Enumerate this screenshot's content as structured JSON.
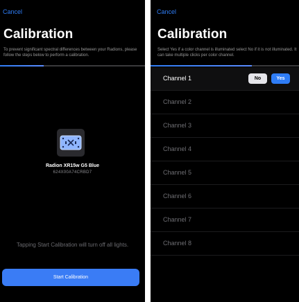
{
  "left_screen": {
    "cancel_label": "Cancel",
    "title": "Calibration",
    "description": "To prevent significant spectral differences between your Radions, please follow the steps below to perform a calibration.",
    "progress": 0.3,
    "device": {
      "icon": "light-fixture-icon",
      "name": "Radion XR15w G5 Blue",
      "serial": "624X00A74CRBD7"
    },
    "hint": "Tapping Start Calibration will turn off all lights.",
    "start_button_label": "Start Calibration"
  },
  "right_screen": {
    "cancel_label": "Cancel",
    "title": "Calibration",
    "description": "Select Yes if a color channel is illuminated select No if it is not illuminated. It can take multiple clicks per color channel.",
    "progress": 0.68,
    "no_label": "No",
    "yes_label": "Yes",
    "channels": [
      {
        "label": "Channel 1"
      },
      {
        "label": "Channel 2"
      },
      {
        "label": "Channel 3"
      },
      {
        "label": "Channel 4"
      },
      {
        "label": "Channel 5"
      },
      {
        "label": "Channel 6"
      },
      {
        "label": "Channel 7"
      },
      {
        "label": "Channel 8"
      }
    ]
  },
  "colors": {
    "accent": "#2f7df6",
    "background": "#000000",
    "divider": "#ffffff"
  }
}
